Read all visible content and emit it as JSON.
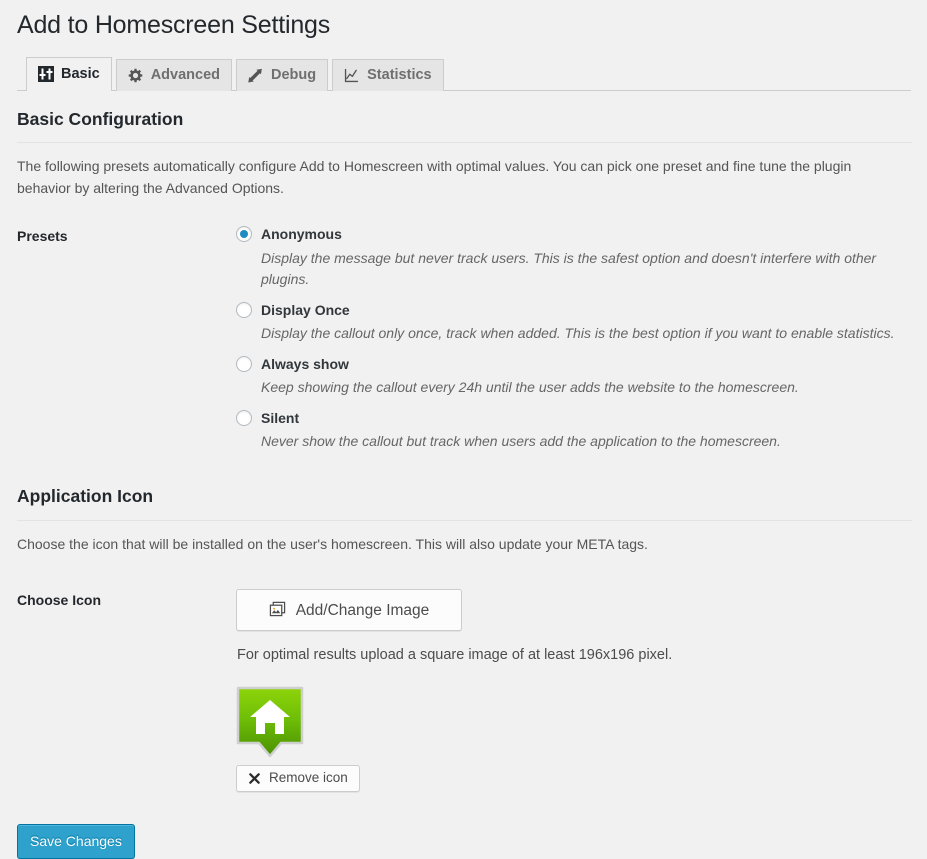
{
  "header": {
    "title": "Add to Homescreen Settings"
  },
  "tabs": [
    {
      "label": "Basic",
      "icon": "sliders-icon",
      "active": true
    },
    {
      "label": "Advanced",
      "icon": "gear-icon",
      "active": false
    },
    {
      "label": "Debug",
      "icon": "hammer-icon",
      "active": false
    },
    {
      "label": "Statistics",
      "icon": "line-chart-icon",
      "active": false
    }
  ],
  "basic_configuration": {
    "heading": "Basic Configuration",
    "description": "The following presets automatically configure Add to Homescreen with optimal values. You can pick one preset and fine tune the plugin behavior by altering the Advanced Options.",
    "presets_label": "Presets",
    "presets": [
      {
        "label": "Anonymous",
        "description": "Display the message but never track users. This is the safest option and doesn't interfere with other plugins.",
        "checked": true
      },
      {
        "label": "Display Once",
        "description": "Display the callout only once, track when added. This is the best option if you want to enable statistics.",
        "checked": false
      },
      {
        "label": "Always show",
        "description": "Keep showing the callout every 24h until the user adds the website to the homescreen.",
        "checked": false
      },
      {
        "label": "Silent",
        "description": "Never show the callout but track when users add the application to the homescreen.",
        "checked": false
      }
    ]
  },
  "application_icon": {
    "heading": "Application Icon",
    "description": "Choose the icon that will be installed on the user's homescreen. This will also update your META tags.",
    "choose_icon_label": "Choose Icon",
    "add_change_image_label": "Add/Change Image",
    "help_text": "For optimal results upload a square image of at least 196x196 pixel.",
    "remove_icon_label": "Remove icon",
    "preview_icon_name": "green-home-callout-icon"
  },
  "footer": {
    "save_label": "Save Changes"
  },
  "colors": {
    "page_background": "#f1f1f1",
    "primary_button": "#2ea2cc",
    "primary_button_border": "#0074a2",
    "radio_checked": "#1e8cbe",
    "icon_green_light": "#7ac70c",
    "icon_green_dark": "#4e9a06",
    "heading_text": "#23282d"
  }
}
